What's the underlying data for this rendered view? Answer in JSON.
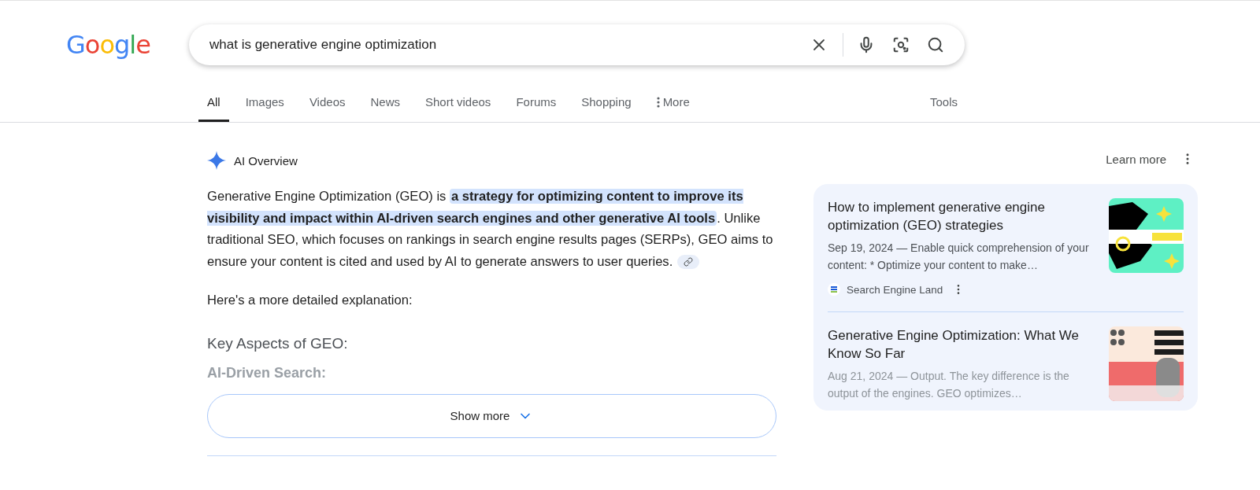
{
  "logo": {
    "text": "Google"
  },
  "search": {
    "value": "what is generative engine optimization"
  },
  "tabs": [
    {
      "label": "All",
      "selected": true
    },
    {
      "label": "Images",
      "selected": false
    },
    {
      "label": "Videos",
      "selected": false
    },
    {
      "label": "News",
      "selected": false
    },
    {
      "label": "Short videos",
      "selected": false
    },
    {
      "label": "Forums",
      "selected": false
    },
    {
      "label": "Shopping",
      "selected": false
    },
    {
      "label": "More",
      "selected": false,
      "kind": "menu"
    }
  ],
  "tools": "Tools",
  "ai_overview": {
    "title": "AI Overview",
    "learn_more": "Learn more",
    "paragraphs": [
      "Generative Engine Optimization (GEO) is **a strategy for optimizing content to improve its visibility and impact within AI-driven search engines and other generative AI tools**. Unlike traditional SEO, which focuses on rankings in search engine results pages (SERPs), GEO aims to ensure your content is cited and used by AI to generate answers to user queries.",
      "Here's a more detailed explanation:"
    ],
    "heading": "Key Aspects of GEO:",
    "subheading": "AI-Driven Search:",
    "show_more": "Show more"
  },
  "sources": [
    {
      "title": "How to implement generative engine optimization (GEO) strategies",
      "snippet": "Sep 19, 2024 — Enable quick comprehension of your content: * Optimize your content to make…",
      "site": "Search Engine Land",
      "faded": false
    },
    {
      "title": "Generative Engine Optimization: What We Know So Far",
      "snippet": "Aug 21, 2024 — Output. The key difference is the output of the engines. GEO optimizes…",
      "faded": true
    }
  ]
}
